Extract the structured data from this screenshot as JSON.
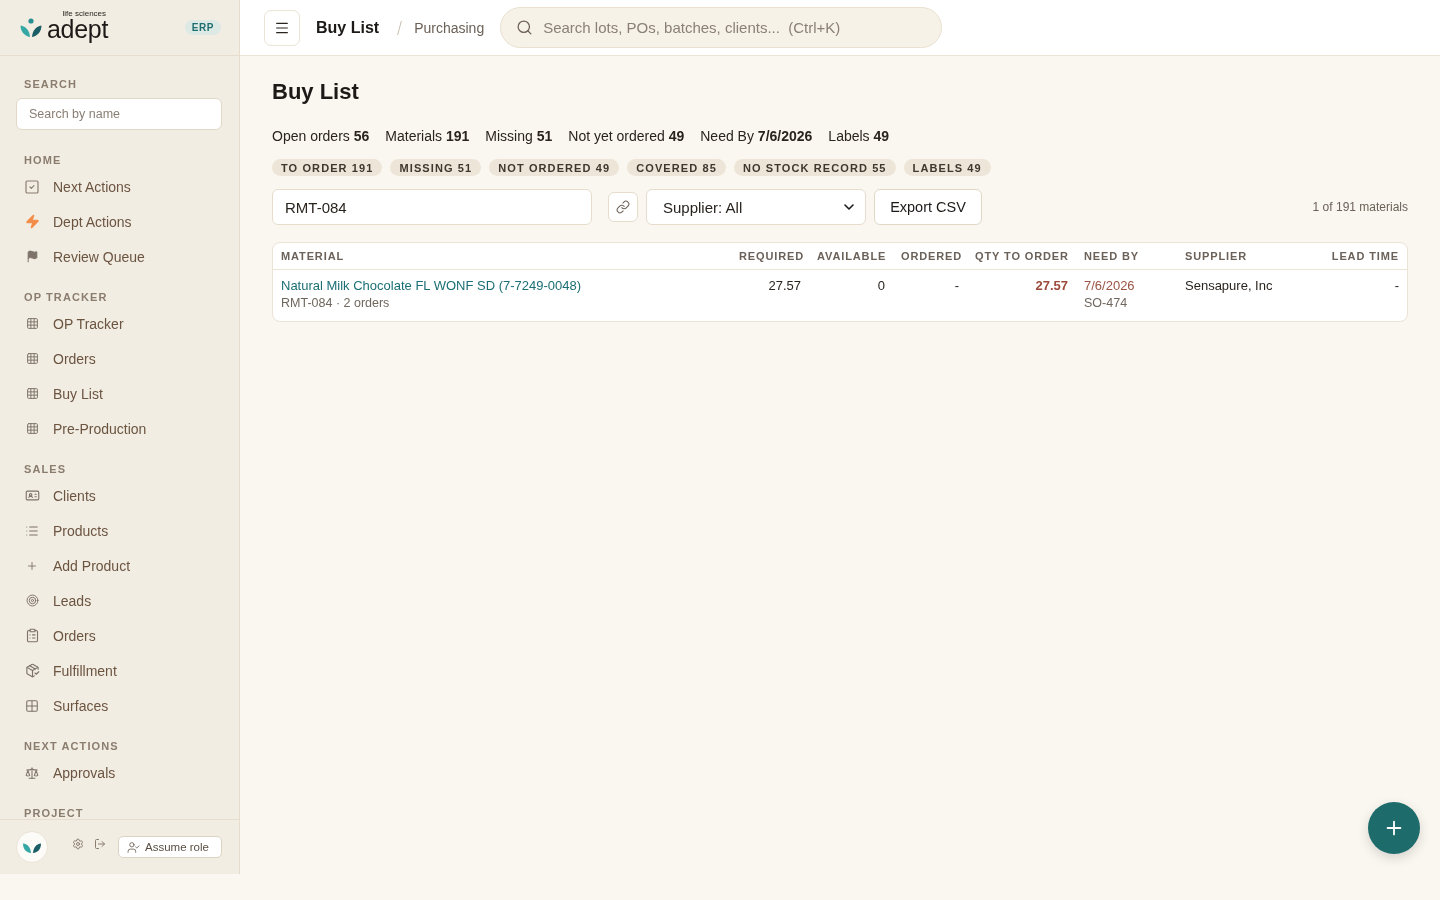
{
  "brand": {
    "name": "adept",
    "tagline": "life sciences",
    "badge": "ERP"
  },
  "sidebar": {
    "search": {
      "label": "SEARCH",
      "placeholder": "Search by name"
    },
    "sections": [
      {
        "title": "HOME",
        "items": [
          {
            "label": "Next Actions",
            "kind": "check",
            "selected": false
          },
          {
            "label": "Dept Actions",
            "kind": "bolt",
            "selected": false
          },
          {
            "label": "Review Queue",
            "kind": "flag",
            "selected": false
          }
        ]
      },
      {
        "title": "OP TRACKER",
        "items": [
          {
            "label": "OP Tracker",
            "kind": "table",
            "selected": false
          },
          {
            "label": "Orders",
            "kind": "table",
            "selected": false
          },
          {
            "label": "Buy List",
            "kind": "table",
            "selected": false
          },
          {
            "label": "Pre-Production",
            "kind": "table",
            "selected": false
          }
        ]
      },
      {
        "title": "SALES",
        "items": [
          {
            "label": "Clients",
            "kind": "card",
            "selected": false
          },
          {
            "label": "Products",
            "kind": "list",
            "selected": false
          },
          {
            "label": "Add Product",
            "kind": "plus",
            "selected": false
          },
          {
            "label": "Leads",
            "kind": "target",
            "selected": false
          },
          {
            "label": "Orders",
            "kind": "clipboard",
            "selected": false
          },
          {
            "label": "Fulfillment",
            "kind": "package",
            "selected": false
          },
          {
            "label": "Surfaces",
            "kind": "grid",
            "selected": false
          }
        ]
      },
      {
        "title": "NEXT ACTIONS",
        "items": [
          {
            "label": "Approvals",
            "kind": "scales",
            "selected": false
          }
        ]
      },
      {
        "title": "PROJECT"
      }
    ],
    "footer": {
      "assume_role": "Assume role"
    }
  },
  "topbar": {
    "title": "Buy List",
    "section": "Purchasing",
    "search": {
      "placeholder": "Search lots, POs, batches, clients...  (Ctrl+K)"
    }
  },
  "page": {
    "title": "Buy List",
    "stats": [
      "Open orders **56**",
      "Materials **191**",
      "Missing **51**",
      "Not yet ordered **49**",
      "Need By **7/6/2026**",
      "Labels **49**"
    ],
    "chips": [
      "TO ORDER 191",
      "MISSING 51",
      "NOT ORDERED 49",
      "COVERED 85",
      "NO STOCK RECORD 55",
      "LABELS 49"
    ],
    "filter": {
      "value": "RMT-084"
    },
    "supplier_select": {
      "value": "Supplier: All"
    },
    "export_button": "Export CSV",
    "result_count": "1 of 191 materials"
  },
  "table": {
    "columns": [
      "MATERIAL",
      "REQUIRED",
      "AVAILABLE",
      "ORDERED",
      "QTY TO ORDER",
      "NEED BY",
      "SUPPLIER",
      "LEAD TIME"
    ],
    "rows": [
      {
        "material": "Natural Milk Chocolate FL WONF SD (7-7249-0048)",
        "material_meta": "RMT-084 · 2 orders",
        "required": "27.57",
        "available": "0",
        "ordered": "-",
        "qty_to_order": "27.57",
        "need_by": "7/6/2026",
        "need_by_ref": "SO-474",
        "urgent": true,
        "supplier": "Sensapure, Inc",
        "lead_time": "-"
      }
    ]
  }
}
